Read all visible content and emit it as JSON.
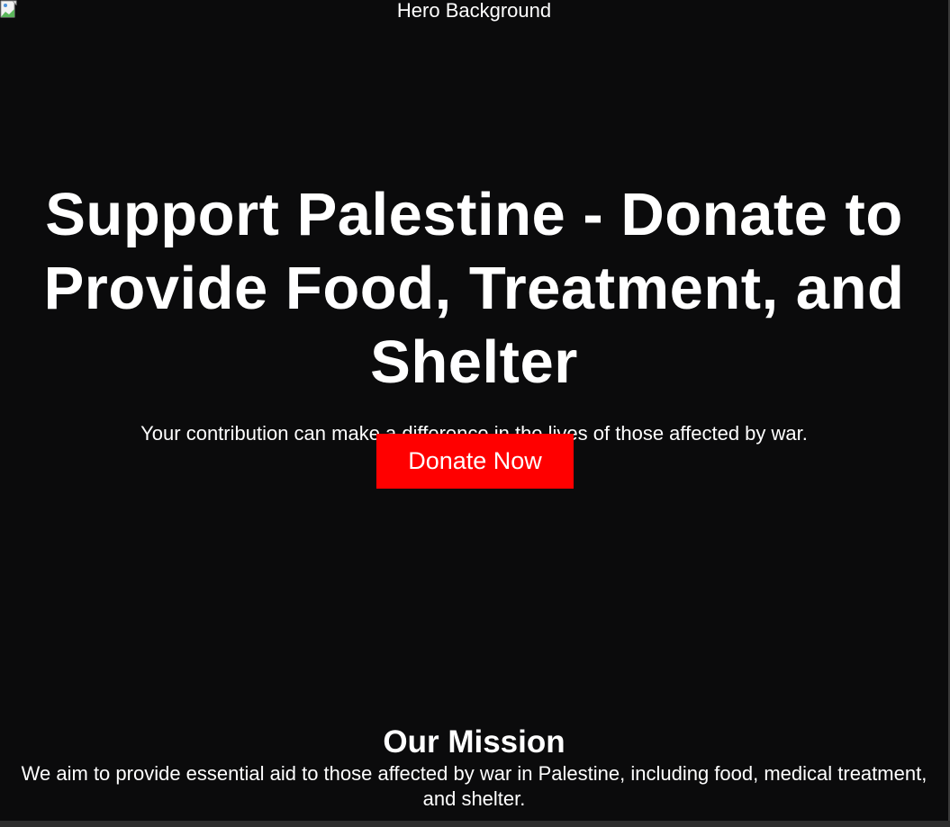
{
  "hero": {
    "image_alt": "Hero Background",
    "image_icon": "broken-image-icon",
    "title": "Support Palestine - Donate to Provide Food, Treatment, and Shelter",
    "subtitle": "Your contribution can make a difference in the lives of those affected by war.",
    "donate_label": "Donate Now"
  },
  "mission": {
    "title": "Our Mission",
    "text": "We aim to provide essential aid to those affected by war in Palestine, including food, medical treatment, and shelter."
  },
  "colors": {
    "background": "#0b0b0c",
    "text": "#ffffff",
    "donate_button": "#ff0000"
  }
}
